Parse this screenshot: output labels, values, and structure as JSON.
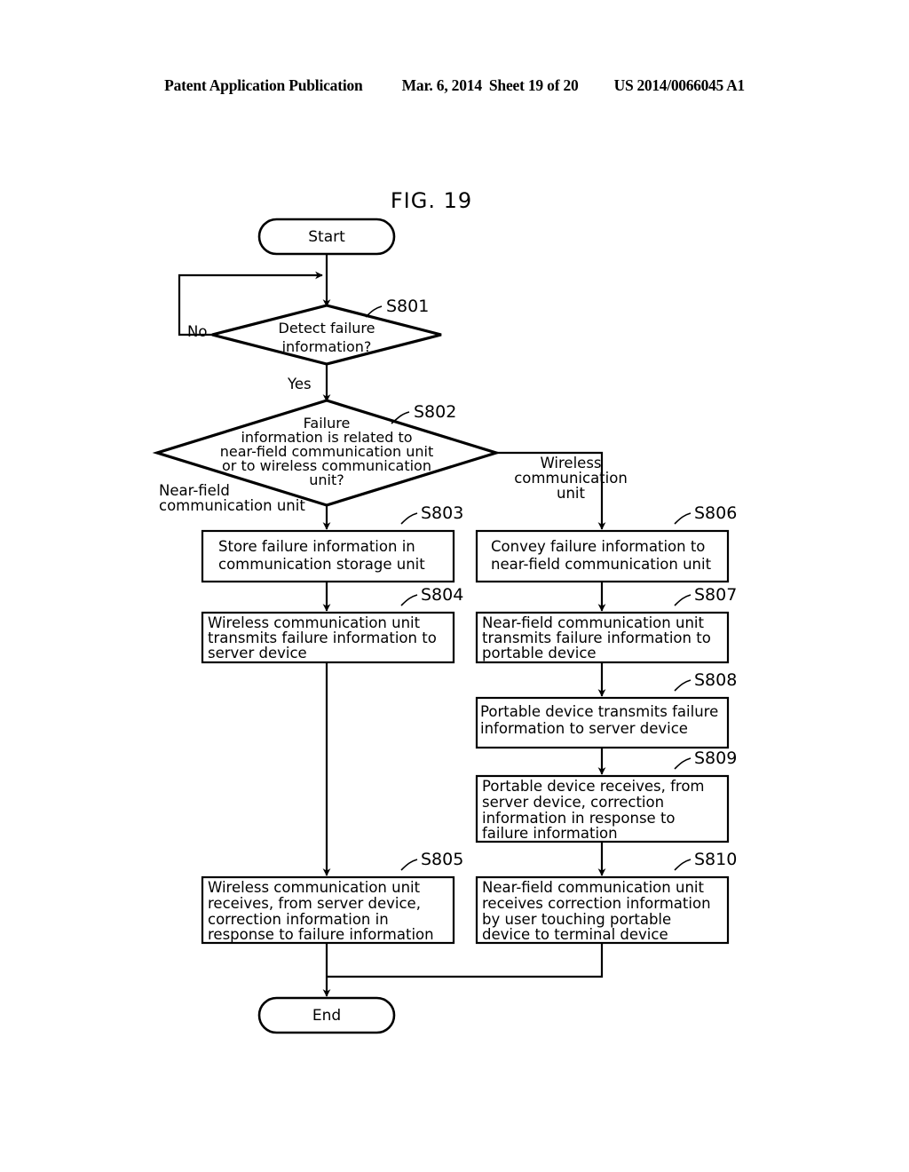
{
  "header": {
    "publication": "Patent Application Publication",
    "date": "Mar. 6, 2014",
    "sheet": "Sheet 19 of 20",
    "patent_number": "US 2014/0066045 A1"
  },
  "figure": {
    "label": "FIG. 19"
  },
  "flowchart": {
    "start": {
      "label": "Start"
    },
    "end": {
      "label": "End"
    },
    "decisions": [
      {
        "id": "S801",
        "step": "S801",
        "lines": [
          "Detect failure",
          "information?"
        ],
        "branch_no": "No",
        "branch_yes": "Yes"
      },
      {
        "id": "S802",
        "step": "S802",
        "lines": [
          "Failure",
          "information is related to",
          "near-field communication unit",
          "or to wireless communication",
          "unit?"
        ],
        "branch_left": [
          "Near-field",
          "communication unit"
        ],
        "branch_right": [
          "Wireless",
          "communication",
          "unit"
        ]
      }
    ],
    "steps": [
      {
        "id": "S803",
        "step": "S803",
        "column": "left",
        "lines": [
          "Store failure information in",
          "communication storage unit"
        ]
      },
      {
        "id": "S804",
        "step": "S804",
        "column": "left",
        "lines": [
          "Wireless communication unit",
          "transmits failure information to",
          "server device"
        ]
      },
      {
        "id": "S805",
        "step": "S805",
        "column": "left",
        "lines": [
          "Wireless communication unit",
          "receives, from server device,",
          "correction information in",
          "response to failure information"
        ]
      },
      {
        "id": "S806",
        "step": "S806",
        "column": "right",
        "lines": [
          "Convey failure information to",
          "near-field communication unit"
        ]
      },
      {
        "id": "S807",
        "step": "S807",
        "column": "right",
        "lines": [
          "Near-field communication unit",
          "transmits failure information to",
          "portable device"
        ]
      },
      {
        "id": "S808",
        "step": "S808",
        "column": "right",
        "lines": [
          "Portable device transmits failure",
          "information to server device"
        ]
      },
      {
        "id": "S809",
        "step": "S809",
        "column": "right",
        "lines": [
          "Portable device receives, from",
          "server device, correction",
          "information in response to",
          "failure information"
        ]
      },
      {
        "id": "S810",
        "step": "S810",
        "column": "right",
        "lines": [
          "Near-field communication unit",
          "receives correction information",
          "by user touching portable",
          "device to terminal device"
        ]
      }
    ]
  },
  "colors": {
    "ink": "#000000",
    "paper": "#ffffff"
  }
}
